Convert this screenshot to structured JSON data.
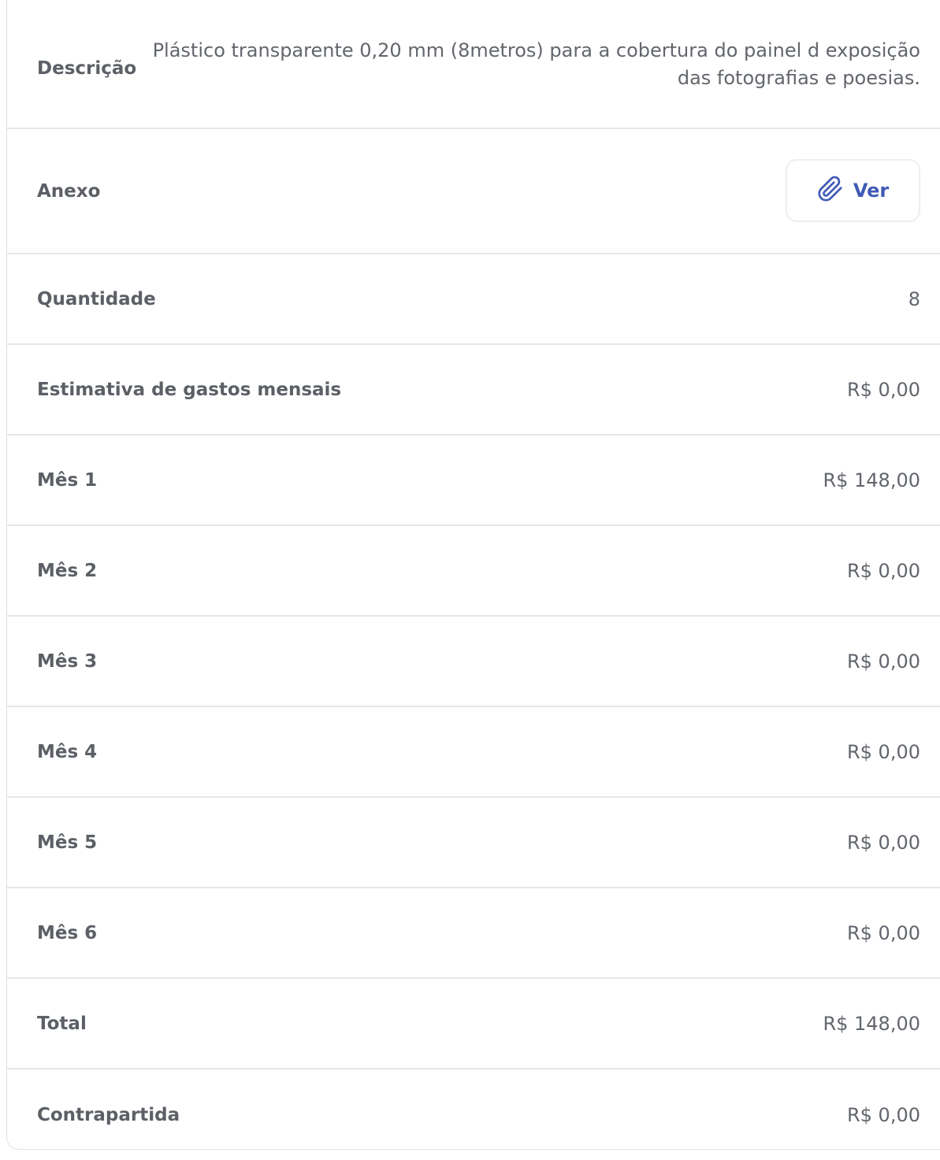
{
  "details": {
    "description": {
      "label": "Descrição",
      "value": "Plástico transparente 0,20 mm (8metros) para a cobertura do painel d exposição das fotografias e poesias."
    },
    "attachment": {
      "label": "Anexo",
      "button_label": "Ver",
      "icon": "paperclip-icon",
      "accent": "#3f5ab5"
    },
    "rows": [
      {
        "label": "Quantidade",
        "value": "8"
      },
      {
        "label": "Estimativa de gastos mensais",
        "value": "R$ 0,00"
      },
      {
        "label": "Mês 1",
        "value": "R$ 148,00"
      },
      {
        "label": "Mês 2",
        "value": "R$ 0,00"
      },
      {
        "label": "Mês 3",
        "value": "R$ 0,00"
      },
      {
        "label": "Mês 4",
        "value": "R$ 0,00"
      },
      {
        "label": "Mês 5",
        "value": "R$ 0,00"
      },
      {
        "label": "Mês 6",
        "value": "R$ 0,00"
      },
      {
        "label": "Total",
        "value": "R$ 148,00"
      },
      {
        "label": "Contrapartida",
        "value": "R$ 0,00"
      }
    ]
  }
}
